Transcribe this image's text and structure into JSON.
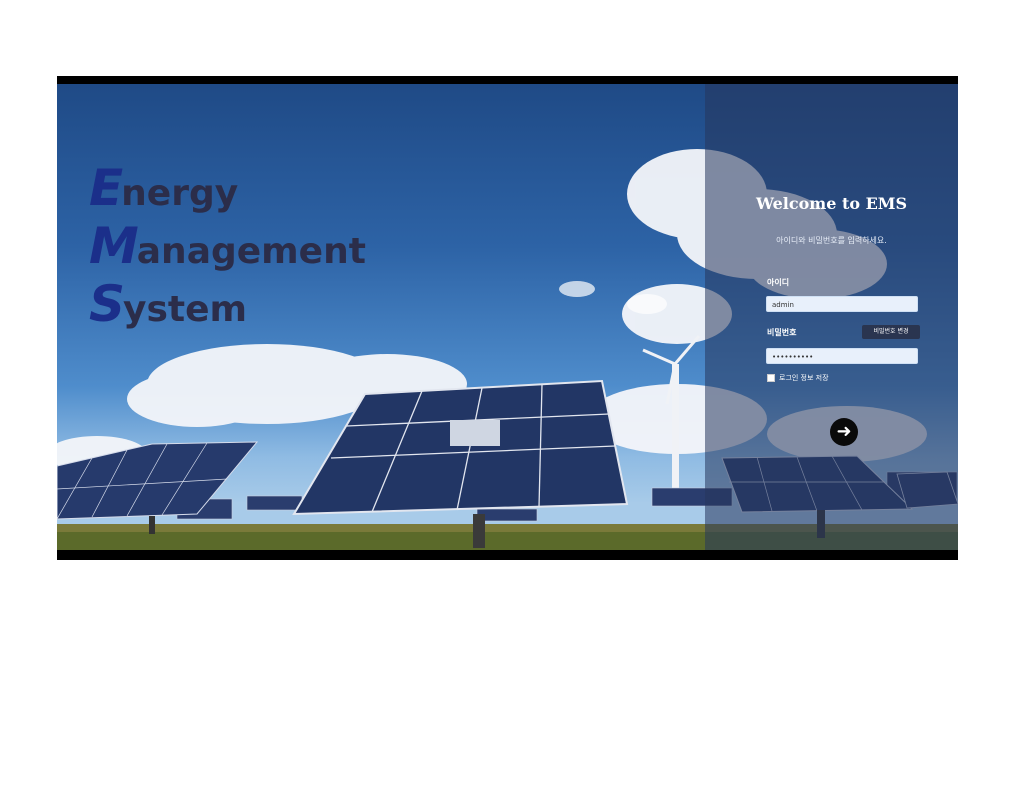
{
  "brand": {
    "line1_cap": "E",
    "line1_rest": "nergy",
    "line2_cap": "M",
    "line2_rest": "anagement",
    "line3_cap": "S",
    "line3_rest": "ystem"
  },
  "login": {
    "title": "Welcome to EMS",
    "instruction": "아이디와 비밀번호를 입력하세요.",
    "id_label": "아이디",
    "id_value": "admin",
    "password_label": "비밀번호",
    "password_value": "••••••••••",
    "change_password_label": "비밀번호 변경",
    "remember_label": "로그인 정보 저장",
    "submit_icon": "arrow-right-icon"
  },
  "colors": {
    "brand_letter": "#1b2f8a",
    "brand_text": "#2b2d4a",
    "panel": "rgba(38,55,92,0.55)"
  }
}
